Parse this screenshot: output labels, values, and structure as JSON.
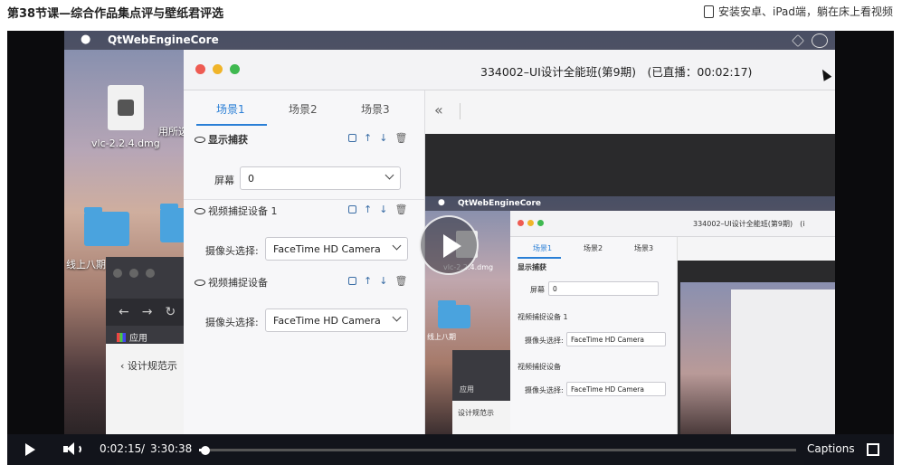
{
  "page": {
    "lesson_title": "第38节课—综合作品集点评与壁纸君评选",
    "app_promo": "安装安卓、iPad端，躺在床上看视频",
    "app_promo_icon": "tablet-icon"
  },
  "video_frame": {
    "mac_menubar": {
      "app_name": "QtWebEngineCore"
    },
    "desktop": {
      "file_label": "vlc-2.2.4.dmg",
      "partial_label_1": "用所选",
      "partial_label_2": "线上八期",
      "browser": {
        "apps_label": "应用",
        "breadcrumb": "设计规范示"
      }
    },
    "qt_window": {
      "title": "334002–UI设计全能班(第9期)　(已直播：00:02:17)",
      "tabs": [
        "场景1",
        "场景2",
        "场景3"
      ],
      "active_tab_index": 0,
      "sections": [
        {
          "heading": "显示捕获",
          "field_label": "屏幕",
          "field_value": "0"
        },
        {
          "heading": "视频捕捉设备 1",
          "field_label": "摄像头选择:",
          "field_value": "FaceTime HD Camera"
        },
        {
          "heading": "视频捕捉设备",
          "field_label": "摄像头选择:",
          "field_value": "FaceTime HD Camera"
        }
      ],
      "collapse_label": "«"
    },
    "nested_window": {
      "title": "334002–UI设计全能班(第9期)　(i",
      "menubar_name": "QtWebEngineCore",
      "tabs": [
        "场景1",
        "场景2",
        "场景3"
      ],
      "sections": [
        {
          "heading": "显示捕获",
          "field_label": "屏幕",
          "field_value": "0"
        },
        {
          "heading": "视频捕捉设备 1",
          "field_label": "摄像头选择:",
          "field_value": "FaceTime HD Camera"
        },
        {
          "heading": "视频捕捉设备",
          "field_label": "摄像头选择:",
          "field_value": "FaceTime HD Camera"
        }
      ],
      "file_label": "vlc-2.2.4.dmg",
      "partial_label": "线上八期",
      "apps_label": "应用",
      "breadcrumb": "设计规范示"
    }
  },
  "player_controls": {
    "current_time": "0:02:15",
    "separator": "/",
    "duration": "3:30:38",
    "progress_fraction": 0.0107,
    "captions_label": "Captions"
  },
  "colors": {
    "accent": "#2a7fd6",
    "traffic_red": "#ee5b52",
    "traffic_yellow": "#f0b429",
    "traffic_green": "#3fb950"
  }
}
